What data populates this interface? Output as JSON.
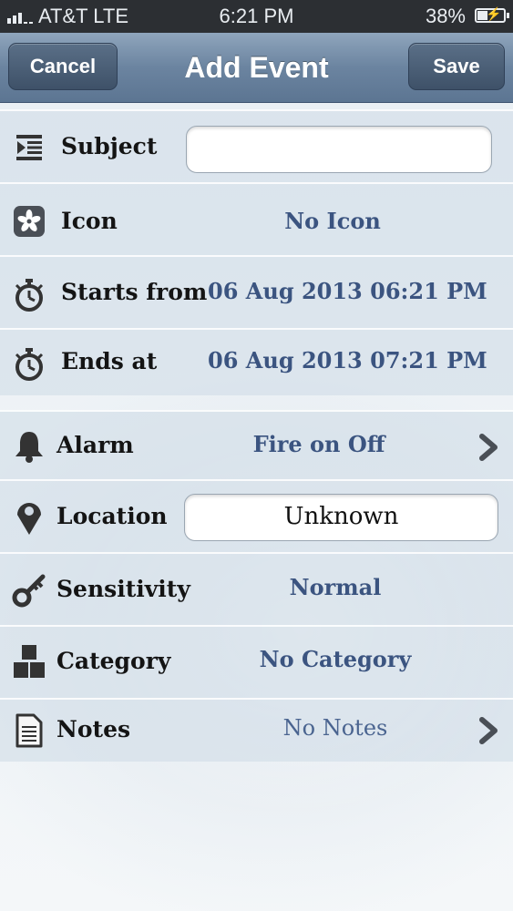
{
  "status_bar": {
    "carrier": "AT&T  LTE",
    "time": "6:21 PM",
    "battery_percent": "38%",
    "battery_level": 0.38
  },
  "nav": {
    "cancel_label": "Cancel",
    "title": "Add Event",
    "save_label": "Save"
  },
  "form": {
    "subject": {
      "label": "Subject",
      "value": "",
      "icon": "subject-icon"
    },
    "icon": {
      "label": "Icon",
      "value": "No Icon",
      "icon": "flower-icon"
    },
    "starts_from": {
      "label": "Starts from",
      "value": "06 Aug 2013 06:21 PM",
      "icon": "stopwatch-icon"
    },
    "ends_at": {
      "label": "Ends at",
      "value": "06 Aug 2013 07:21 PM",
      "icon": "stopwatch-icon"
    },
    "alarm": {
      "label": "Alarm",
      "value": "Fire on Off",
      "icon": "bell-icon"
    },
    "location": {
      "label": "Location",
      "value": "Unknown",
      "icon": "map-pin-icon"
    },
    "sensitivity": {
      "label": "Sensitivity",
      "value": "Normal",
      "icon": "key-icon"
    },
    "category": {
      "label": "Category",
      "value": "No Category",
      "icon": "blocks-icon"
    },
    "notes": {
      "label": "Notes",
      "value": "No Notes",
      "icon": "document-icon"
    }
  },
  "colors": {
    "value_text": "#3b5480",
    "nav_bar": "#6b84a0"
  }
}
